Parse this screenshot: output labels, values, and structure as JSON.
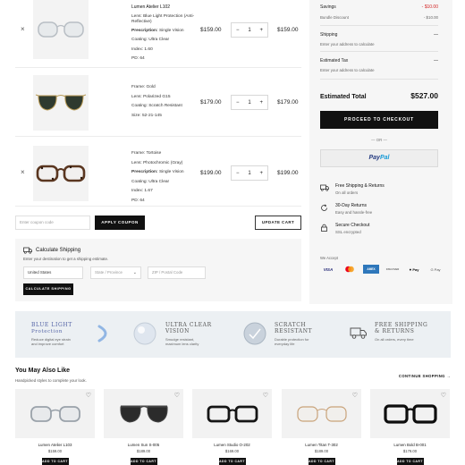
{
  "cart": {
    "items": [
      {
        "name": "Lumen Atelier L102",
        "specs": [
          {
            "label": "Lens:",
            "value": "Blue Light Protection (Anti-Reflective)"
          },
          {
            "label": "Prescription:",
            "value": "Single Vision"
          },
          {
            "label": "Coating:",
            "value": "Ultra Clear"
          },
          {
            "label": "Index:",
            "value": "1.60"
          },
          {
            "label": "PD:",
            "value": "64"
          }
        ],
        "price": "$159.00",
        "quantity": "1",
        "total": "$159.00"
      },
      {
        "name": "",
        "specs": [
          {
            "label": "Frame:",
            "value": "Gold"
          },
          {
            "label": "Lens:",
            "value": "Polarized G15"
          },
          {
            "label": "Coating:",
            "value": "Scratch Resistant"
          },
          {
            "label": "Size:",
            "value": "52-21-145"
          }
        ],
        "price": "$179.00",
        "quantity": "1",
        "total": "$179.00"
      },
      {
        "name": "",
        "specs": [
          {
            "label": "Frame:",
            "value": "Tortoise"
          },
          {
            "label": "Lens:",
            "value": "Photochromic (Gray)"
          },
          {
            "label": "Prescription:",
            "value": "Single Vision"
          },
          {
            "label": "Coating:",
            "value": "Ultra Clear"
          },
          {
            "label": "Index:",
            "value": "1.67"
          },
          {
            "label": "PD:",
            "value": "64"
          }
        ],
        "price": "$199.00",
        "quantity": "1",
        "total": "$199.00"
      }
    ],
    "remove_glyph": "×",
    "minus_glyph": "−",
    "plus_glyph": "+"
  },
  "coupon": {
    "placeholder": "Enter coupon code",
    "apply_label": "APPLY COUPON",
    "update_label": "UPDATE CART"
  },
  "calc_shipping": {
    "title": "Calculate Shipping",
    "subtitle": "Enter your destination to get a shipping estimate.",
    "country": "United States",
    "state_placeholder": "State / Province",
    "zip_placeholder": "ZIP / Postal Code",
    "button_label": "CALCULATE SHIPPING"
  },
  "summary": {
    "savings_label": "Savings",
    "savings_value": "- $10.00",
    "bundle_label": "Bundle Discount",
    "bundle_value": "- $10.00",
    "shipping_label": "Shipping",
    "shipping_value": "—",
    "shipping_note": "Enter your address to calculate",
    "tax_label": "Estimated Tax",
    "tax_value": "—",
    "tax_note": "Enter your address to calculate",
    "total_label": "Estimated Total",
    "total_value": "$527.00",
    "checkout_label": "PROCEED TO CHECKOUT",
    "or_label": "— OR —",
    "paypal_pay": "Pay",
    "paypal_pal": "Pal",
    "features": [
      {
        "title": "Free Shipping & Returns",
        "sub": "On all orders",
        "icon": "truck-icon"
      },
      {
        "title": "30-Day Returns",
        "sub": "Easy and hassle-free",
        "icon": "return-icon"
      },
      {
        "title": "Secure Checkout",
        "sub": "SSL encrypted",
        "icon": "lock-icon"
      }
    ],
    "accept_label": "We Accept",
    "cards": [
      "VISA",
      "",
      "AMEX",
      "DISCOVER",
      "Pay",
      "G Pay"
    ]
  },
  "benefits": [
    {
      "title": "Blue Light",
      "title2": "Protection",
      "sub": "Reduce digital eye strain",
      "sub2": "and improve comfort"
    },
    {
      "title": "Ultra Clear",
      "title2": "Vision",
      "sub": "Smudge resistant,",
      "sub2": "maximum lens clarity"
    },
    {
      "title": "Scratch",
      "title2": "Resistant",
      "sub": "Durable protection for",
      "sub2": "everyday life"
    },
    {
      "title": "Free Shipping",
      "title2": "& Returns",
      "sub": "On all orders, every time",
      "sub2": ""
    }
  ],
  "recommendations": {
    "title": "You May Also Like",
    "subtitle": "Handpicked styles to complete your look.",
    "continue_label": "CONTINUE SHOPPING →",
    "products": [
      {
        "name": "Lumen Atelier L103",
        "price": "$159.00",
        "button": "ADD TO CART"
      },
      {
        "name": "Lumen Sun S-005",
        "price": "$189.00",
        "button": "ADD TO CART"
      },
      {
        "name": "Lumen Studio O-202",
        "price": "$169.00",
        "button": "ADD TO CART"
      },
      {
        "name": "Lumen Titan T-302",
        "price": "$189.00",
        "button": "ADD TO CART"
      },
      {
        "name": "Lumen Bold B-001",
        "price": "$179.00",
        "button": "ADD TO CART"
      }
    ]
  },
  "colors": {
    "accent_dark": "#111111",
    "savings_red": "#d32020",
    "panel_bg": "#f6f6f6",
    "benefits_bg": "#ecf0f3"
  }
}
